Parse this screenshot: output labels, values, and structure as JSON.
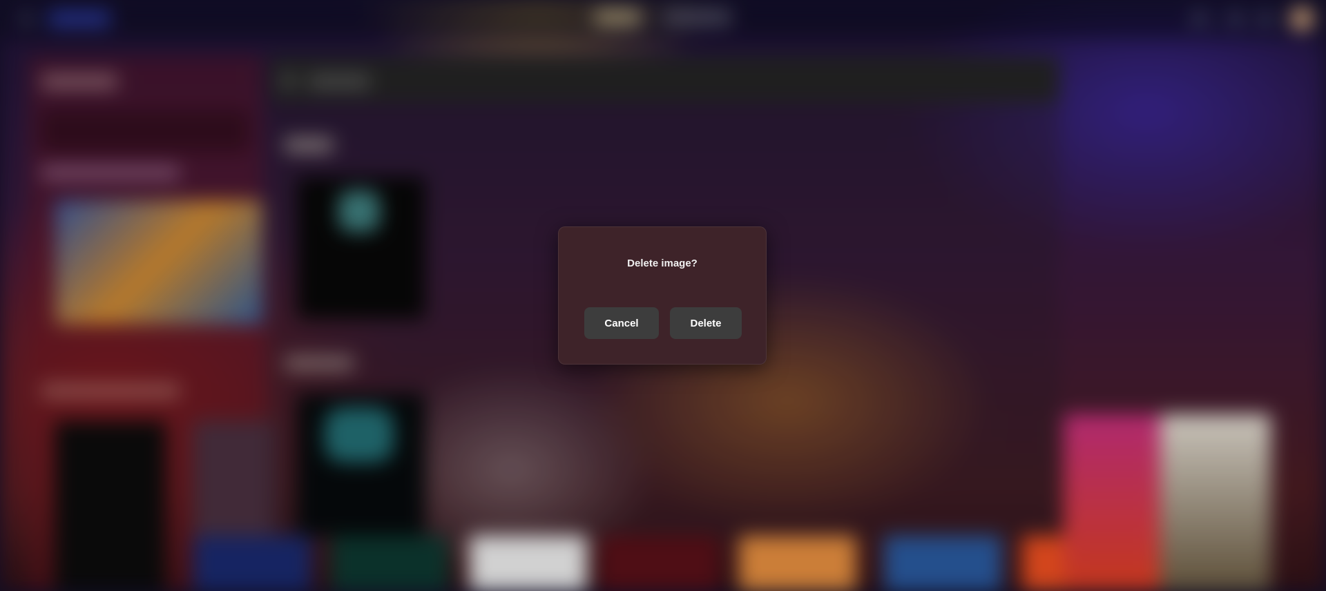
{
  "dialog": {
    "title": "Delete image?",
    "cancel_label": "Cancel",
    "delete_label": "Delete"
  },
  "colors": {
    "dialog_background": "#3e2329",
    "button_background": "#3d3d3d",
    "text": "#f0f0f0"
  }
}
